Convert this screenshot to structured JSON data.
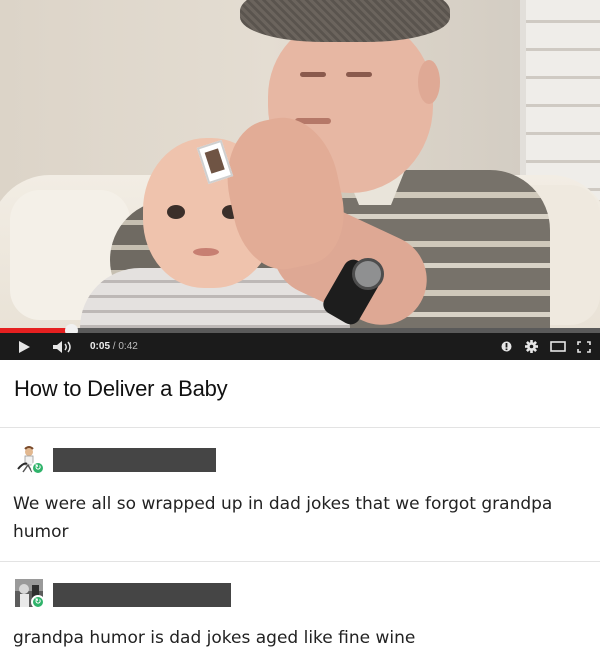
{
  "video": {
    "progress_fraction": 0.119,
    "current_time": "0:05",
    "separator": " / ",
    "duration": "0:42",
    "icons": [
      "play-icon",
      "volume-icon",
      "annotations-icon",
      "settings-icon",
      "theater-mode-icon",
      "fullscreen-icon"
    ]
  },
  "title": "How to Deliver a Baby",
  "posts": [
    {
      "comment_lines": [
        "We were all so wrapped up in dad jokes that we forgot grandpa",
        "humor"
      ]
    },
    {
      "comment_lines": [
        "grandpa humor is dad jokes aged like fine wine"
      ]
    }
  ],
  "colors": {
    "progress": "#e52020",
    "controls_bg": "#1b1b1b",
    "reblog_badge": "#2fb36a",
    "redaction": "#454545"
  }
}
